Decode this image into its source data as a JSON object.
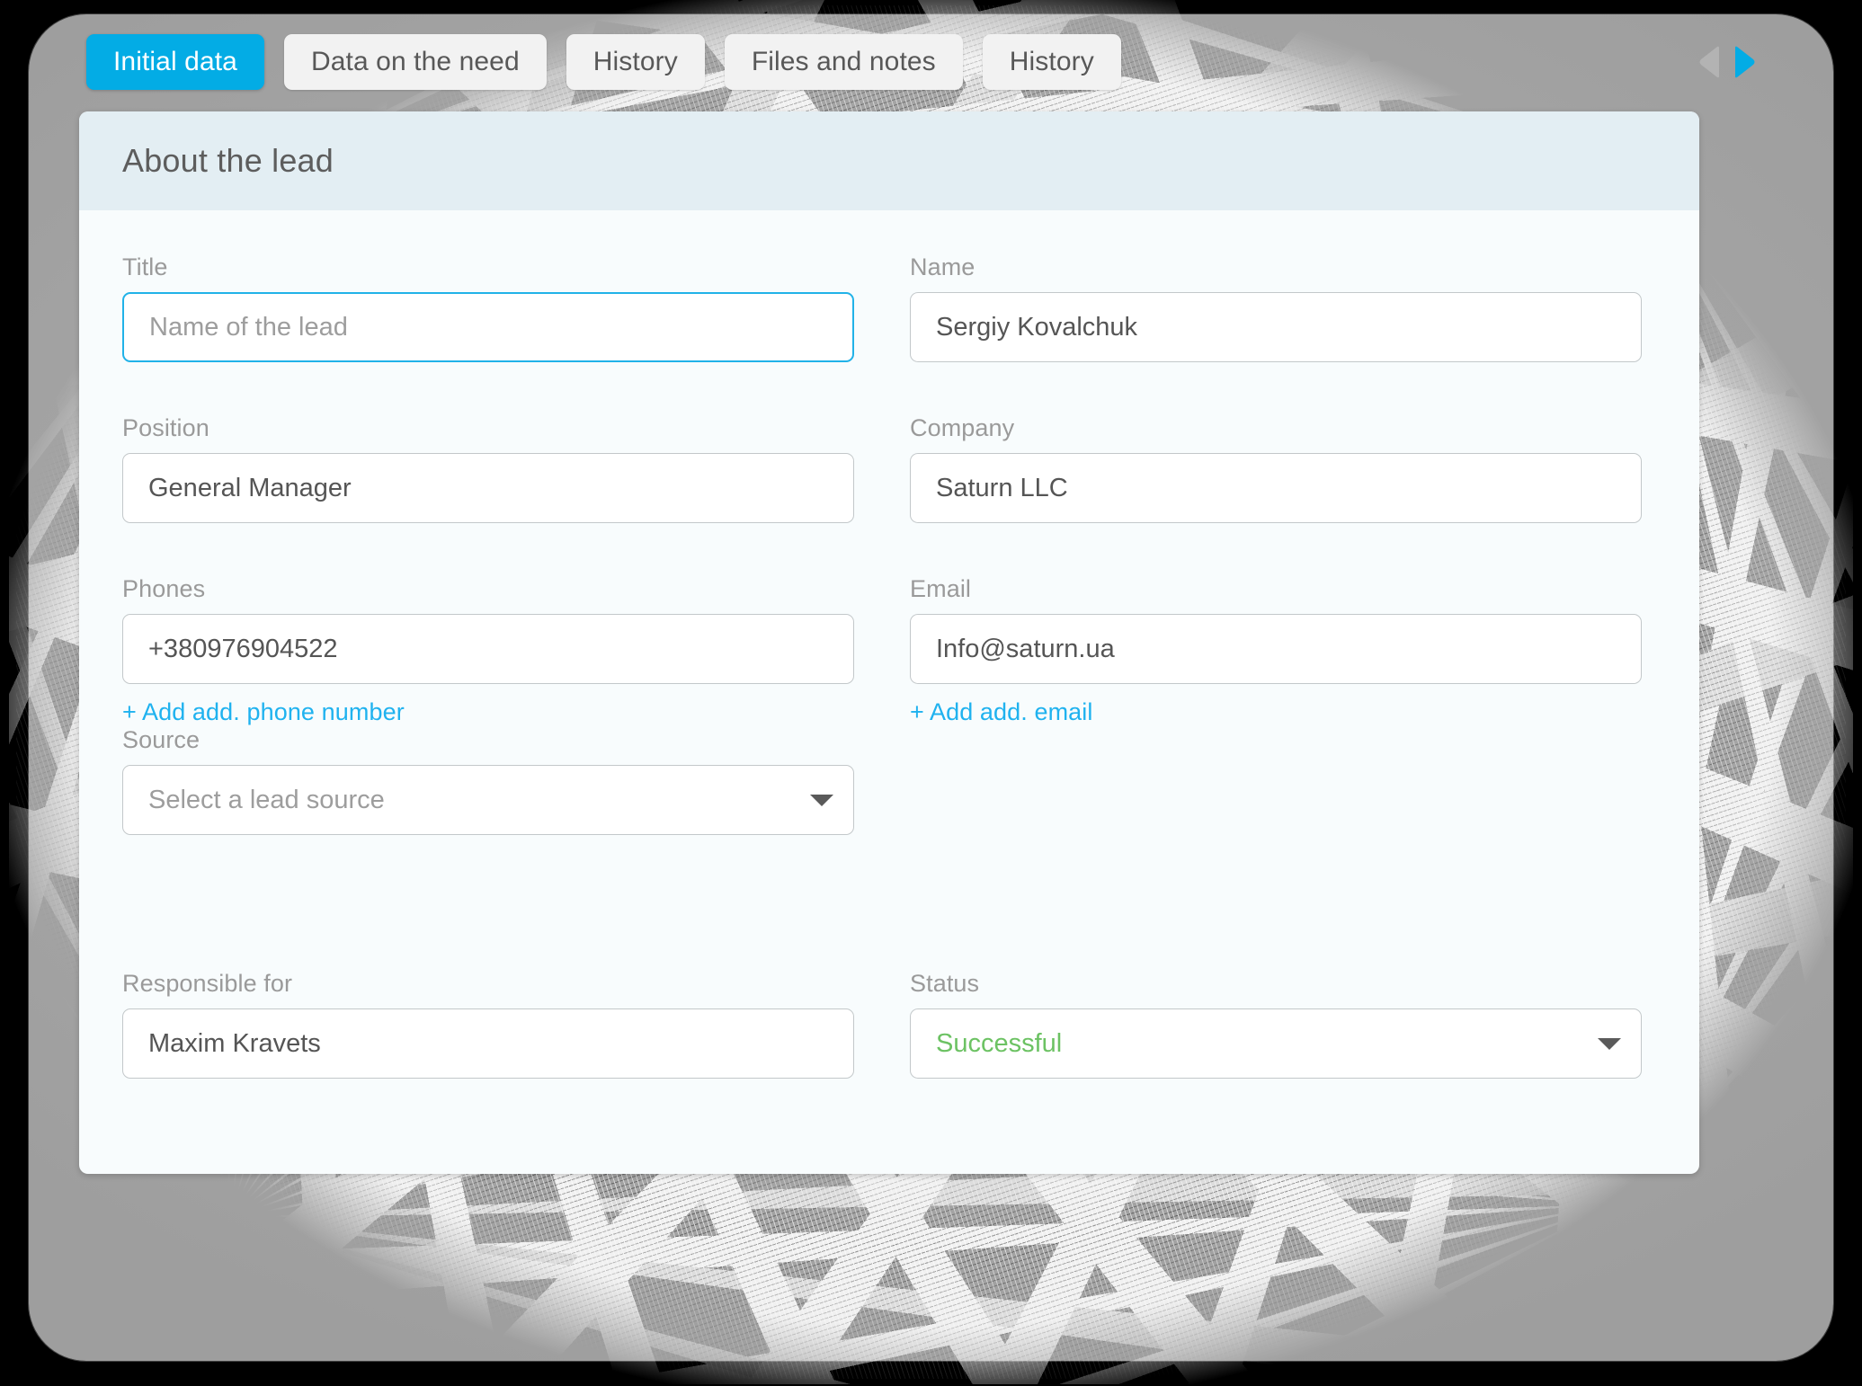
{
  "tabs": [
    {
      "label": "Initial data",
      "active": true
    },
    {
      "label": "Data on the need",
      "active": false
    },
    {
      "label": "History",
      "active": false
    },
    {
      "label": "Files and notes",
      "active": false
    },
    {
      "label": "History",
      "active": false
    }
  ],
  "tab_nav": {
    "prev_icon": "triangle-left-icon",
    "next_icon": "triangle-right-icon",
    "prev_color": "#b3b3b3",
    "next_color": "#03ace5"
  },
  "card": {
    "header_title": "About the lead"
  },
  "fields": {
    "title": {
      "label": "Title",
      "value": "",
      "placeholder": "Name of the lead",
      "focused": true
    },
    "name": {
      "label": "Name",
      "value": "Sergiy Kovalchuk",
      "placeholder": ""
    },
    "position": {
      "label": "Position",
      "value": "General Manager",
      "placeholder": ""
    },
    "company": {
      "label": "Company",
      "value": "Saturn LLC",
      "placeholder": ""
    },
    "phones": {
      "label": "Phones",
      "value": "+380976904522",
      "placeholder": "",
      "add_link": "+ Add add. phone number"
    },
    "email": {
      "label": "Email",
      "value": "Info@saturn.ua",
      "placeholder": "",
      "add_link": "+ Add add. email"
    },
    "source": {
      "label": "Source",
      "value": "",
      "placeholder": "Select a lead source",
      "caret_icon": "chevron-down-icon"
    },
    "responsible": {
      "label": "Responsible for",
      "value": "Maxim Kravets",
      "placeholder": ""
    },
    "status": {
      "label": "Status",
      "value": "Successful",
      "placeholder": "",
      "caret_icon": "chevron-down-icon"
    }
  },
  "colors": {
    "accent": "#03ace5",
    "link": "#1fb2ef",
    "status_success": "#6cc263",
    "header_bg": "#e3eef3",
    "card_bg": "#f8fcfd",
    "backdrop": "#a8a8a8"
  }
}
